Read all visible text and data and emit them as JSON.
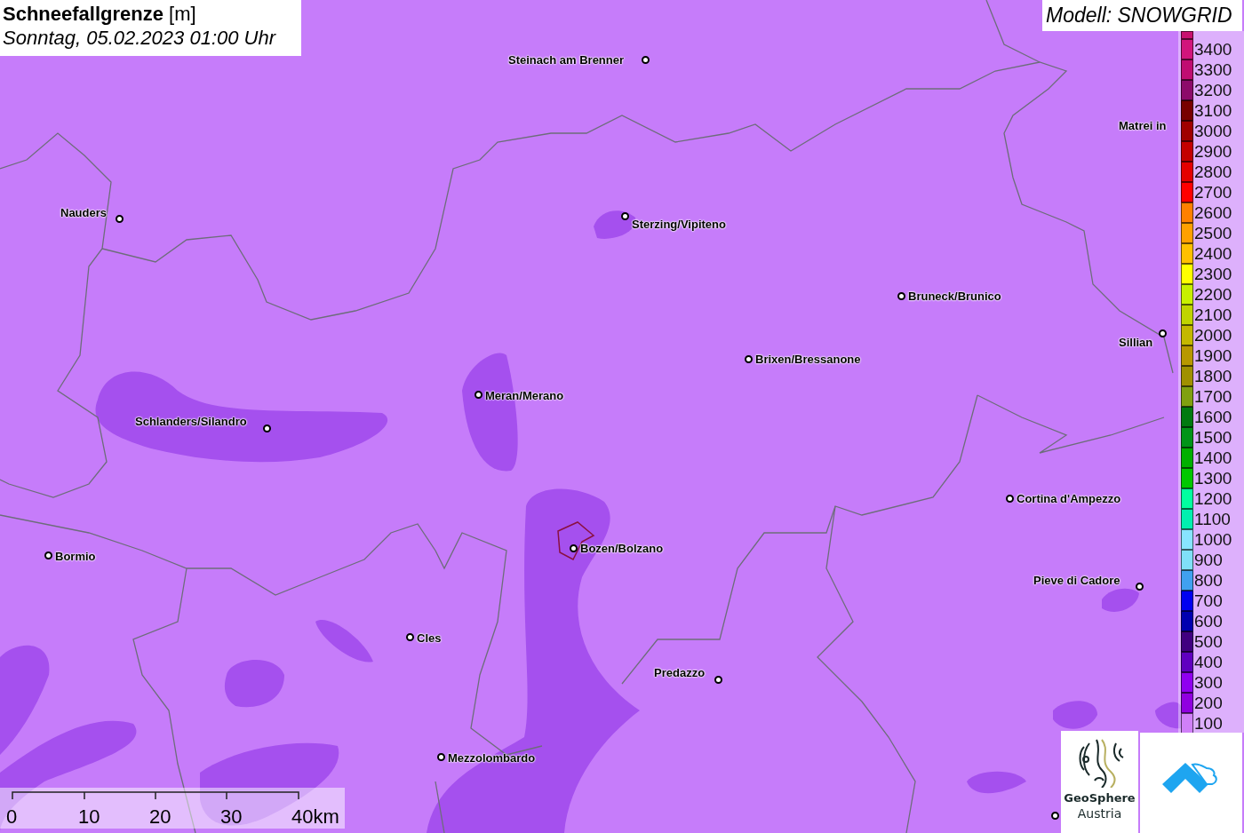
{
  "header": {
    "title": "Schneefallgrenze",
    "unit": "[m]",
    "datetime": "Sonntag, 05.02.2023 01:00 Uhr"
  },
  "model": "Modell: SNOWGRID",
  "legend": [
    {
      "label": "3400",
      "color": "#d2147c"
    },
    {
      "label": "3300",
      "color": "#c00c72"
    },
    {
      "label": "3200",
      "color": "#8c0a6a"
    },
    {
      "label": "3100",
      "color": "#780000"
    },
    {
      "label": "3000",
      "color": "#a00000"
    },
    {
      "label": "2900",
      "color": "#c40000"
    },
    {
      "label": "2800",
      "color": "#e40000"
    },
    {
      "label": "2700",
      "color": "#ff0000"
    },
    {
      "label": "2600",
      "color": "#ff8000"
    },
    {
      "label": "2500",
      "color": "#ffa000"
    },
    {
      "label": "2400",
      "color": "#ffc000"
    },
    {
      "label": "2300",
      "color": "#ffff00"
    },
    {
      "label": "2200",
      "color": "#c8f000"
    },
    {
      "label": "2100",
      "color": "#c0d400"
    },
    {
      "label": "2000",
      "color": "#c4b800"
    },
    {
      "label": "1900",
      "color": "#b89800"
    },
    {
      "label": "1800",
      "color": "#a09000"
    },
    {
      "label": "1700",
      "color": "#80a010"
    },
    {
      "label": "1600",
      "color": "#007a10"
    },
    {
      "label": "1500",
      "color": "#009418"
    },
    {
      "label": "1400",
      "color": "#00b000"
    },
    {
      "label": "1300",
      "color": "#00c800"
    },
    {
      "label": "1200",
      "color": "#00ffa0"
    },
    {
      "label": "1100",
      "color": "#00f0b0"
    },
    {
      "label": "1000",
      "color": "#88e4ff"
    },
    {
      "label": "900",
      "color": "#80e0f8"
    },
    {
      "label": "800",
      "color": "#40a0f0"
    },
    {
      "label": "700",
      "color": "#0000f0"
    },
    {
      "label": "600",
      "color": "#0000b0"
    },
    {
      "label": "500",
      "color": "#400080"
    },
    {
      "label": "400",
      "color": "#6000c0"
    },
    {
      "label": "300",
      "color": "#9000f0"
    },
    {
      "label": "200",
      "color": "#9000e0"
    },
    {
      "label": "100",
      "color": "#d080f8"
    }
  ],
  "cities": [
    "Steinach am Brenner",
    "Matrei in",
    "Nauders",
    "Sterzing/Vipiteno",
    "Bruneck/Brunico",
    "Sillian",
    "Brixen/Bressanone",
    "Meran/Merano",
    "Schlanders/Silandro",
    "Cortina d'Ampezzo",
    "Bormio",
    "Bozen/Bolzano",
    "Pieve di Cadore",
    "Cles",
    "Predazzo",
    "Mezzolombardo"
  ],
  "scale": [
    "0",
    "10",
    "20",
    "30",
    "40km"
  ],
  "logo": {
    "name": "GeoSphere",
    "subtitle": "Austria"
  }
}
